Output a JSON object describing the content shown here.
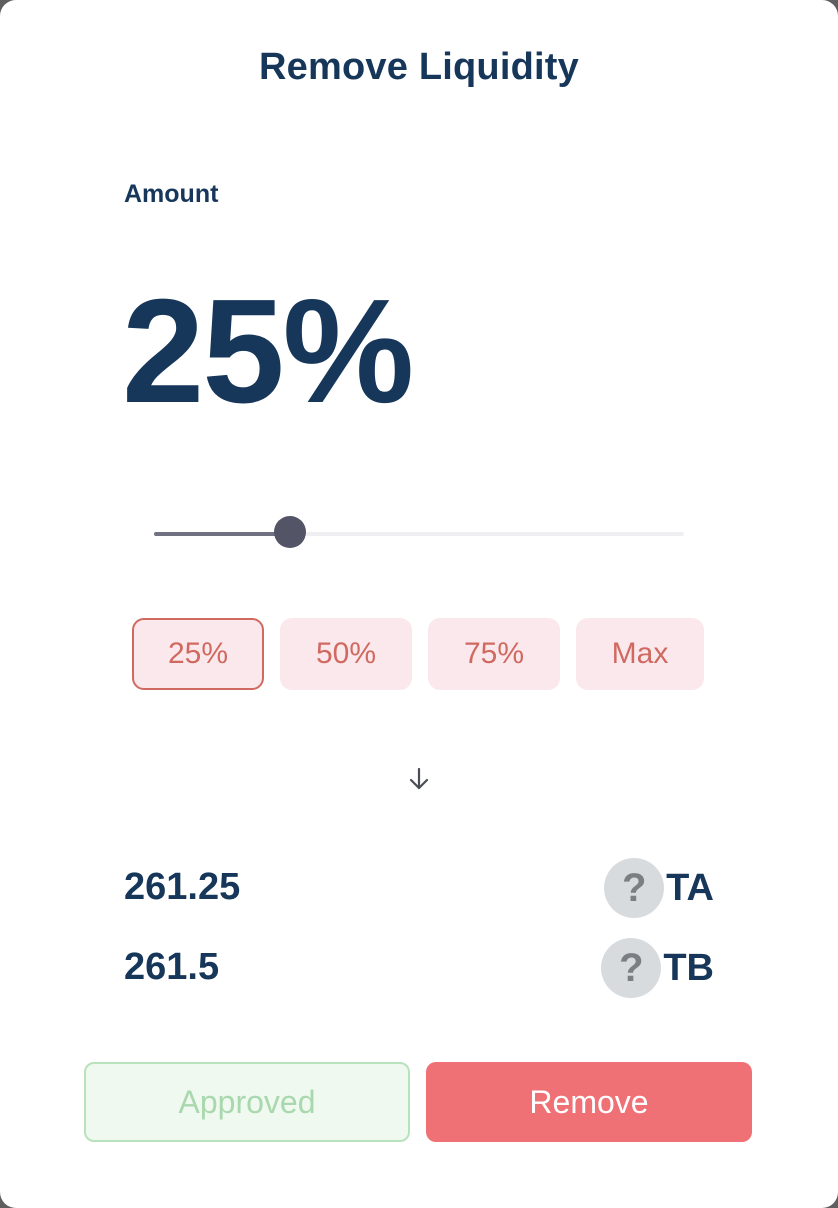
{
  "title": "Remove Liquidity",
  "amount": {
    "label": "Amount",
    "percent_display": "25%"
  },
  "slider": {
    "value_percent": 25
  },
  "presets": [
    {
      "label": "25%",
      "selected": true
    },
    {
      "label": "50%",
      "selected": false
    },
    {
      "label": "75%",
      "selected": false
    },
    {
      "label": "Max",
      "selected": false
    }
  ],
  "arrow_icon": "arrow-down-icon",
  "outputs": [
    {
      "value": "261.25",
      "token_symbol": "TA",
      "token_icon_glyph": "?"
    },
    {
      "value": "261.5",
      "token_symbol": "TB",
      "token_icon_glyph": "?"
    }
  ],
  "buttons": {
    "approved_label": "Approved",
    "remove_label": "Remove"
  },
  "colors": {
    "text_primary": "#17375a",
    "preset_bg": "#fbe8ec",
    "preset_text": "#d06a60",
    "approved_bg": "#eff9ef",
    "approved_text": "#a9d8ae",
    "remove_bg": "#ef7075"
  }
}
